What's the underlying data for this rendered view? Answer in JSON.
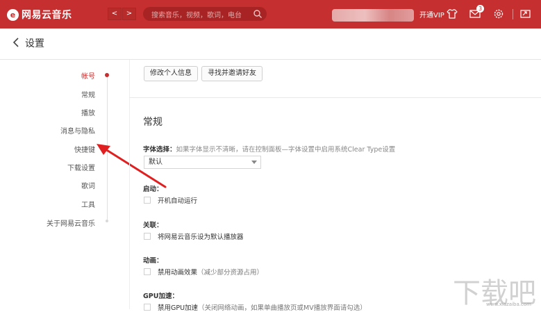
{
  "app": {
    "logo_glyph": "e",
    "title": "网易云音乐",
    "accent_color": "#c62f2f"
  },
  "topbar": {
    "back_glyph": "<",
    "forward_glyph": ">",
    "search_placeholder": "搜索音乐，视频，歌词，电台",
    "vip_label": "开通VIP",
    "message_badge": "3",
    "icons": [
      "skin-icon",
      "mail-icon",
      "settings-icon",
      "mini-mode-icon"
    ]
  },
  "page": {
    "title": "设置"
  },
  "nav": {
    "items": [
      {
        "label": "帐号",
        "active": true
      },
      {
        "label": "常规"
      },
      {
        "label": "播放"
      },
      {
        "label": "消息与隐私"
      },
      {
        "label": "快捷键"
      },
      {
        "label": "下载设置"
      },
      {
        "label": "歌词"
      },
      {
        "label": "工具"
      },
      {
        "label": "关于网易云音乐"
      }
    ]
  },
  "account": {
    "edit_profile": "修改个人信息",
    "invite_friends": "寻找并邀请好友"
  },
  "general": {
    "title": "常规",
    "font_label": "字体选择：",
    "font_hint": "如果字体显示不清晰，请在控制面板—字体设置中启用系统Clear Type设置",
    "font_value": "默认",
    "startup_label": "启动：",
    "startup_option": "开机自动运行",
    "assoc_label": "关联：",
    "assoc_option": "将网易云音乐设为默认播放器",
    "anim_label": "动画：",
    "anim_option": "禁用动画效果",
    "anim_hint": "（减少部分资源占用）",
    "gpu_label": "GPU加速：",
    "gpu_option": "禁用GPU加速",
    "gpu_hint": "（关闭网络动画，如果单曲播放页或MV播放界面请勾选）"
  },
  "watermark": {
    "text": "下载吧",
    "url": "www.xiazaiba.com"
  }
}
